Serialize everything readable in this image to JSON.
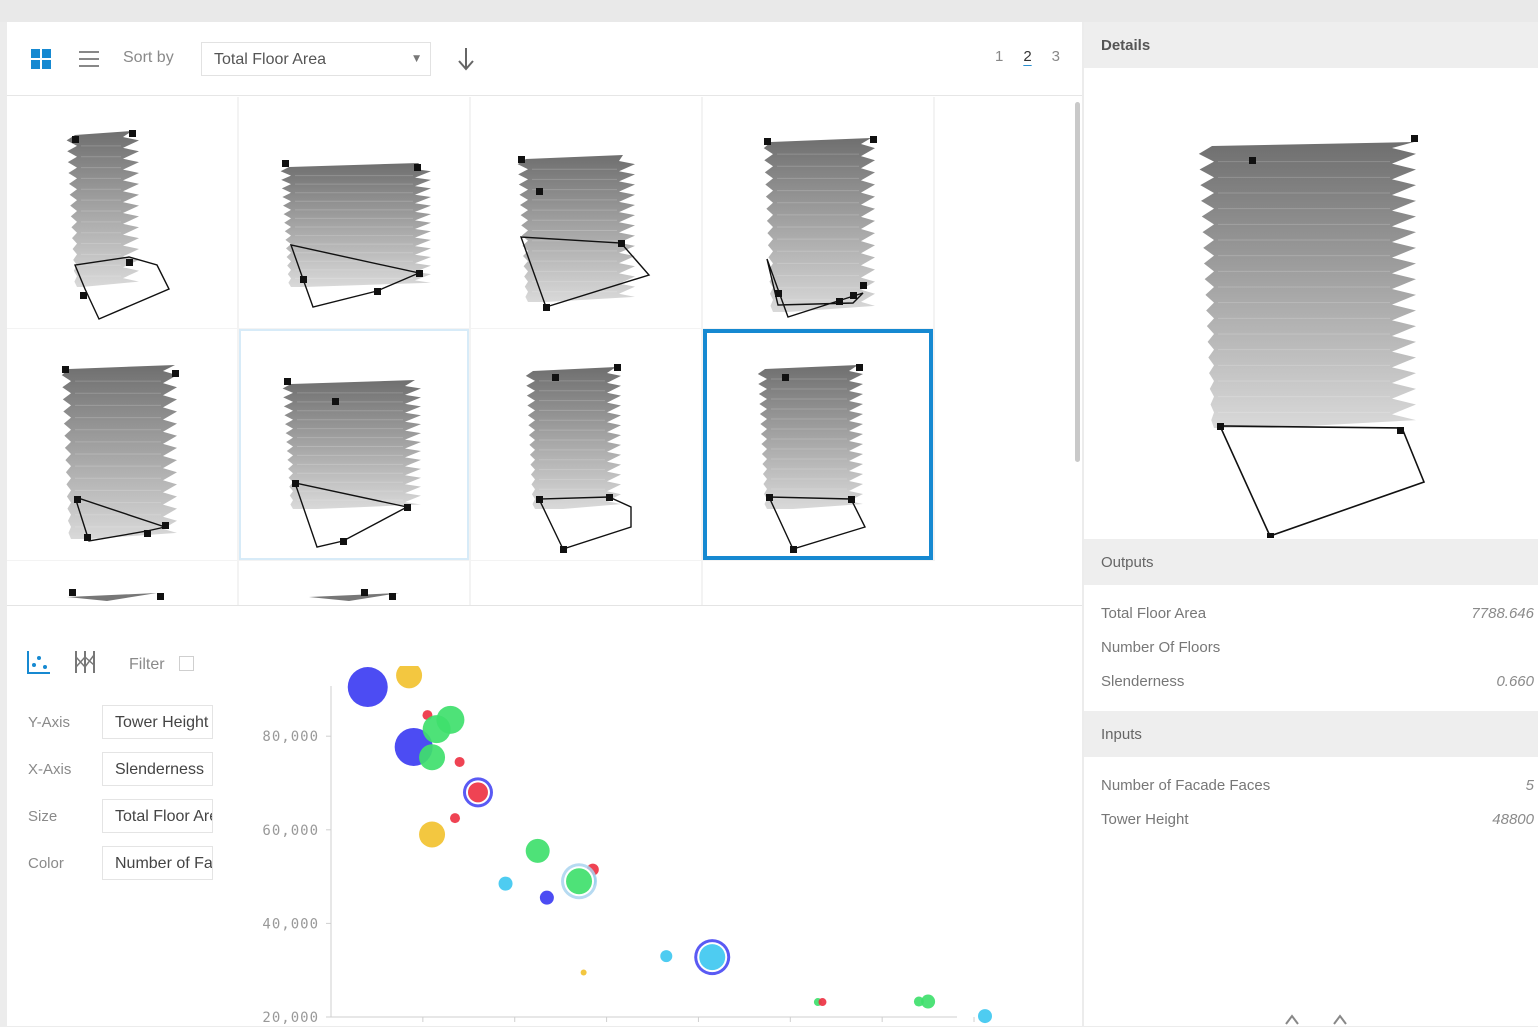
{
  "toolbar": {
    "grid_view_icon": "grid-icon",
    "list_view_icon": "list-icon",
    "sort_label": "Sort by",
    "sort_value": "Total Floor Area",
    "sort_direction_icon": "arrow-down-icon",
    "pages": [
      "1",
      "2",
      "3"
    ],
    "active_page": "2"
  },
  "chart_controls": {
    "scatter_icon": "scatter-plot-icon",
    "parallel_icon": "parallel-coordinates-icon",
    "filter_label": "Filter",
    "axes": [
      {
        "label": "Y-Axis",
        "value": "Tower Height"
      },
      {
        "label": "X-Axis",
        "value": "Slenderness"
      },
      {
        "label": "Size",
        "value": "Total Floor Area"
      },
      {
        "label": "Color",
        "value": "Number of Facade Faces"
      }
    ]
  },
  "details": {
    "header": "Details",
    "outputs_header": "Outputs",
    "outputs": [
      {
        "key": "Total Floor Area",
        "value": "7788.646"
      },
      {
        "key": "Number Of Floors",
        "value": ""
      },
      {
        "key": "Slenderness",
        "value": "0.660"
      }
    ],
    "inputs_header": "Inputs",
    "inputs": [
      {
        "key": "Number of Facade Faces",
        "value": "5"
      },
      {
        "key": "Tower Height",
        "value": "48800"
      }
    ]
  },
  "chart_data": {
    "type": "scatter",
    "title": "",
    "xlabel": "",
    "ylabel": "",
    "xlim": [
      0.2,
      1.65
    ],
    "ylim": [
      20000,
      95000
    ],
    "xticks": [
      "0.4",
      "0.6",
      "0.8",
      "1.0",
      "1.2",
      "1.4",
      "1.6"
    ],
    "yticks": [
      "20,000",
      "40,000",
      "60,000",
      "80,000"
    ],
    "grid": false,
    "legend": "none",
    "points": [
      {
        "x": 0.28,
        "y": 90500,
        "r": 20,
        "color": "#3d3df2"
      },
      {
        "x": 0.37,
        "y": 93000,
        "r": 13,
        "color": "#f2c230"
      },
      {
        "x": 0.38,
        "y": 77700,
        "r": 19,
        "color": "#3d3df2"
      },
      {
        "x": 0.41,
        "y": 84500,
        "r": 5,
        "color": "#ee3344"
      },
      {
        "x": 0.43,
        "y": 81500,
        "r": 14,
        "color": "#3fe06d"
      },
      {
        "x": 0.46,
        "y": 83500,
        "r": 14,
        "color": "#3fe06d"
      },
      {
        "x": 0.42,
        "y": 75500,
        "r": 13,
        "color": "#3fe06d"
      },
      {
        "x": 0.48,
        "y": 74500,
        "r": 5,
        "color": "#ee3344"
      },
      {
        "x": 0.52,
        "y": 68000,
        "r": 10,
        "color": "#ee3344",
        "ring": "#3d3df2"
      },
      {
        "x": 0.47,
        "y": 62500,
        "r": 5,
        "color": "#ee3344"
      },
      {
        "x": 0.42,
        "y": 59000,
        "r": 13,
        "color": "#f2c230"
      },
      {
        "x": 0.58,
        "y": 48500,
        "r": 7,
        "color": "#3fc8f0"
      },
      {
        "x": 0.65,
        "y": 55500,
        "r": 12,
        "color": "#3fe06d"
      },
      {
        "x": 0.67,
        "y": 45500,
        "r": 7,
        "color": "#3d3df2"
      },
      {
        "x": 0.77,
        "y": 51500,
        "r": 6,
        "color": "#ee3344"
      },
      {
        "x": 0.76,
        "y": 49200,
        "r": 8,
        "color": "#3fc8f0"
      },
      {
        "x": 0.74,
        "y": 49000,
        "r": 13,
        "color": "#3fe06d",
        "ring": "#a9d3ef"
      },
      {
        "x": 0.75,
        "y": 29500,
        "r": 3,
        "color": "#f2c230"
      },
      {
        "x": 0.93,
        "y": 33000,
        "r": 6,
        "color": "#3fc8f0"
      },
      {
        "x": 1.03,
        "y": 32800,
        "r": 13,
        "color": "#3fc8f0",
        "ring": "#3d3df2"
      },
      {
        "x": 1.26,
        "y": 23200,
        "r": 4,
        "color": "#3fe06d"
      },
      {
        "x": 1.27,
        "y": 23200,
        "r": 4,
        "color": "#ee3344"
      },
      {
        "x": 1.48,
        "y": 23300,
        "r": 5,
        "color": "#3fe06d"
      },
      {
        "x": 1.5,
        "y": 23300,
        "r": 7,
        "color": "#3fe06d"
      },
      {
        "x": 1.7,
        "y": 20200,
        "r": 7,
        "color": "#3fc8f0"
      }
    ]
  }
}
